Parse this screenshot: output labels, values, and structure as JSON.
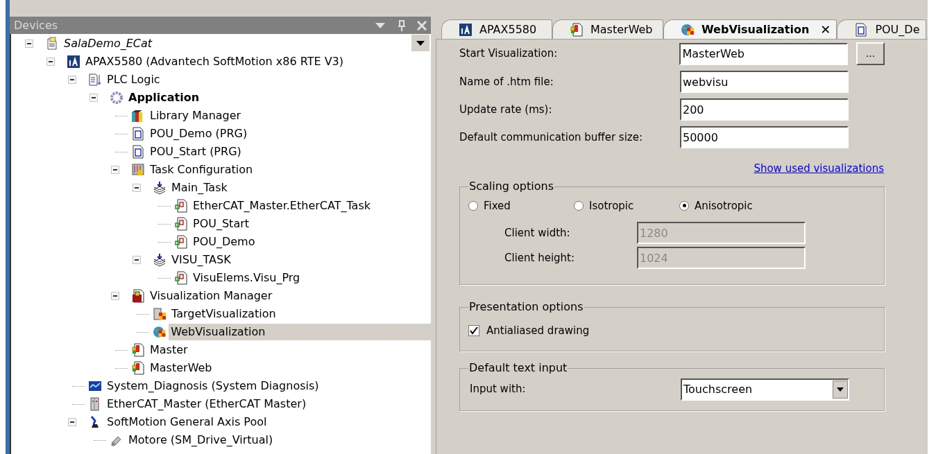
{
  "devices_panel": {
    "title": "Devices",
    "tree": [
      {
        "label": "SalaDemo_ECat",
        "kind": "project",
        "italic": true,
        "expanded": true,
        "selected": false,
        "children": [
          {
            "label": "APAX5580 (Advantech SoftMotion x86 RTE V3)",
            "kind": "device",
            "expanded": true,
            "selected": false,
            "children": [
              {
                "label": "PLC Logic",
                "kind": "plc-logic",
                "expanded": true,
                "selected": false,
                "children": [
                  {
                    "label": "Application",
                    "kind": "application",
                    "bold": true,
                    "expanded": true,
                    "selected": false,
                    "children": [
                      {
                        "label": "Library Manager",
                        "kind": "library",
                        "selected": false
                      },
                      {
                        "label": "POU_Demo (PRG)",
                        "kind": "pou",
                        "selected": false
                      },
                      {
                        "label": "POU_Start (PRG)",
                        "kind": "pou",
                        "selected": false
                      },
                      {
                        "label": "Task Configuration",
                        "kind": "task-config",
                        "expanded": true,
                        "selected": false,
                        "children": [
                          {
                            "label": "Main_Task",
                            "kind": "task",
                            "expanded": true,
                            "selected": false,
                            "children": [
                              {
                                "label": "EtherCAT_Master.EtherCAT_Task",
                                "kind": "call",
                                "selected": false
                              },
                              {
                                "label": "POU_Start",
                                "kind": "call",
                                "selected": false
                              },
                              {
                                "label": "POU_Demo",
                                "kind": "call",
                                "selected": false
                              }
                            ]
                          },
                          {
                            "label": "VISU_TASK",
                            "kind": "task",
                            "expanded": true,
                            "selected": false,
                            "children": [
                              {
                                "label": "VisuElems.Visu_Prg",
                                "kind": "call",
                                "selected": false
                              }
                            ]
                          }
                        ]
                      },
                      {
                        "label": "Visualization Manager",
                        "kind": "visu-manager",
                        "expanded": true,
                        "selected": false,
                        "children": [
                          {
                            "label": "TargetVisualization",
                            "kind": "target-visu",
                            "selected": false
                          },
                          {
                            "label": "WebVisualization",
                            "kind": "web-visu",
                            "selected": true
                          }
                        ]
                      },
                      {
                        "label": "Master",
                        "kind": "visu",
                        "selected": false
                      },
                      {
                        "label": "MasterWeb",
                        "kind": "visu",
                        "selected": false
                      }
                    ]
                  }
                ]
              },
              {
                "label": "System_Diagnosis (System Diagnosis)",
                "kind": "diagnosis",
                "selected": false
              },
              {
                "label": "EtherCAT_Master (EtherCAT Master)",
                "kind": "ethercat",
                "selected": false
              },
              {
                "label": "SoftMotion General Axis Pool",
                "kind": "axis-pool",
                "expanded": true,
                "selected": false,
                "children": [
                  {
                    "label": "Motore (SM_Drive_Virtual)",
                    "kind": "drive",
                    "selected": false
                  }
                ]
              }
            ]
          }
        ]
      }
    ]
  },
  "editor": {
    "tabs": [
      {
        "label": "APAX5580",
        "kind": "device",
        "selected": false
      },
      {
        "label": "MasterWeb",
        "kind": "visu",
        "selected": false
      },
      {
        "label": "WebVisualization",
        "kind": "web-visu",
        "selected": true,
        "close": "✕"
      },
      {
        "label": "POU_De",
        "kind": "pou",
        "selected": false
      }
    ],
    "fields": [
      {
        "label": "Start Visualization:",
        "value": "MasterWeb",
        "browse": "..."
      },
      {
        "label": "Name of .htm file:",
        "value": "webvisu"
      },
      {
        "label": "Update rate (ms):",
        "value": "200"
      },
      {
        "label": "Default communication buffer size:",
        "value": "50000"
      }
    ],
    "link": "Show used visualizations",
    "scaling": {
      "title": "Scaling options",
      "options": [
        {
          "label": "Fixed",
          "selected": false
        },
        {
          "label": "Isotropic",
          "selected": false
        },
        {
          "label": "Anisotropic",
          "selected": true
        }
      ],
      "fields": [
        {
          "label": "Client width:",
          "value": "1280",
          "disabled": true
        },
        {
          "label": "Client height:",
          "value": "1024",
          "disabled": true
        }
      ]
    },
    "presentation": {
      "title": "Presentation options",
      "checkbox": {
        "label": "Antialiased drawing",
        "checked": true
      }
    },
    "text_input": {
      "title": "Default text input",
      "label": "Input with:",
      "value": "Touchscreen"
    }
  }
}
